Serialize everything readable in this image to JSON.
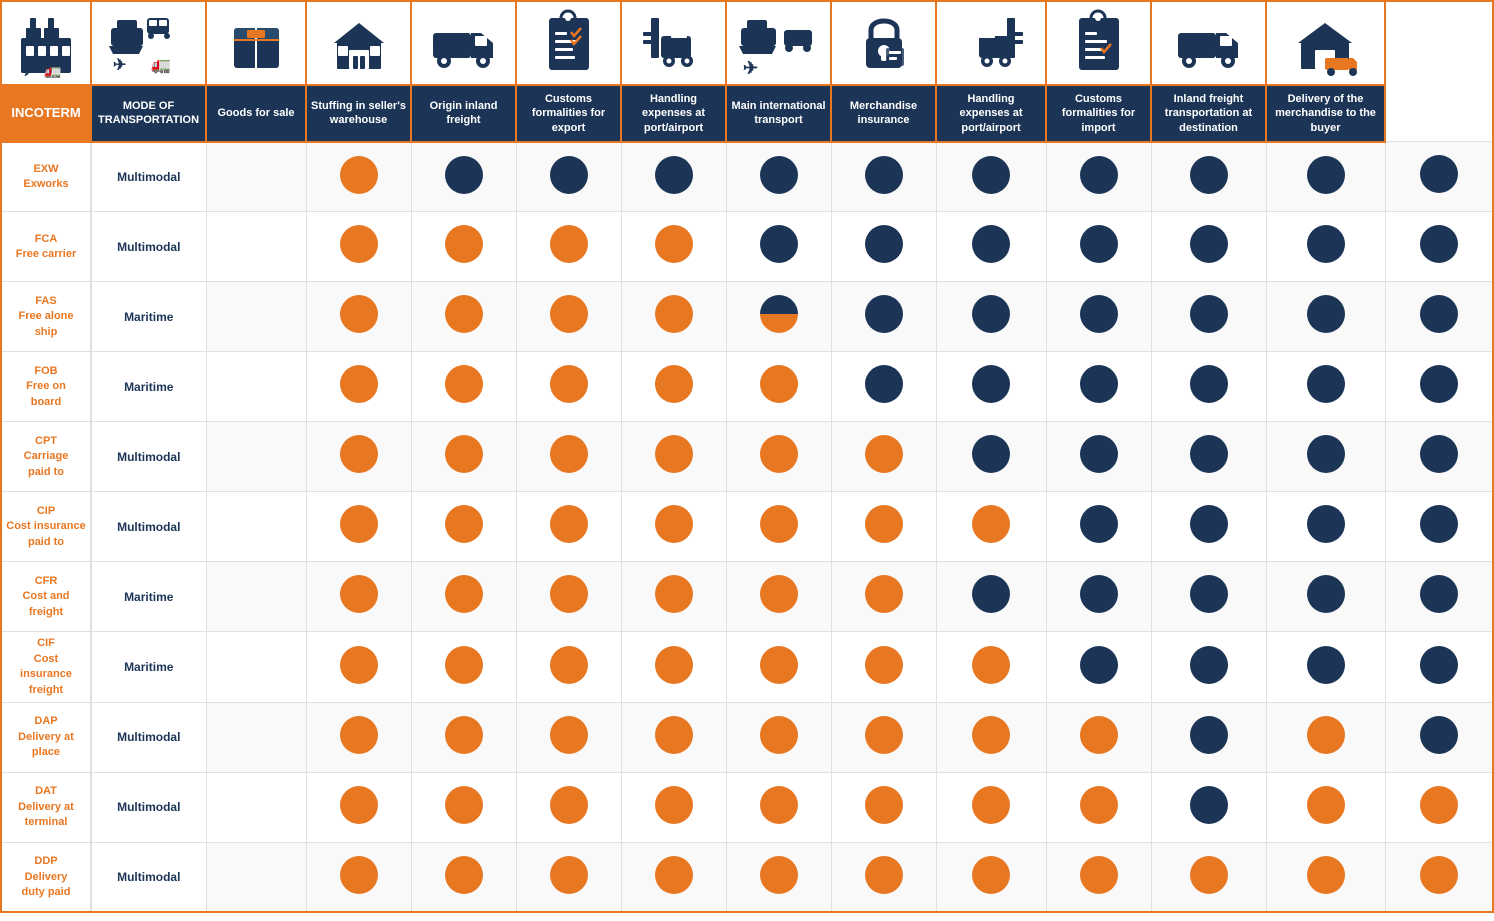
{
  "columns": [
    {
      "id": "incoterm",
      "label": "INCOTERM",
      "icon": "factory"
    },
    {
      "id": "transport",
      "label": "MODE OF TRANSPORTATION",
      "icon": "multimodal"
    },
    {
      "id": "goods",
      "label": "Goods for sale",
      "icon": "box"
    },
    {
      "id": "stuffing",
      "label": "Stuffing in seller's warehouse",
      "icon": "warehouse"
    },
    {
      "id": "origin_inland",
      "label": "Origin inland freight",
      "icon": "truck"
    },
    {
      "id": "customs_export",
      "label": "Customs formalities for export",
      "icon": "checklist"
    },
    {
      "id": "handling_origin",
      "label": "Handling expenses at port/airport",
      "icon": "forklift"
    },
    {
      "id": "main_transport",
      "label": "Main international transport",
      "icon": "ship-plane"
    },
    {
      "id": "insurance",
      "label": "Merchandise insurance",
      "icon": "lock"
    },
    {
      "id": "handling_dest",
      "label": "Handling expenses at port/airport",
      "icon": "forklift2"
    },
    {
      "id": "customs_import",
      "label": "Customs formalities for import",
      "icon": "checklist2"
    },
    {
      "id": "inland_dest",
      "label": "Inland freight transportation at destination",
      "icon": "truck2"
    },
    {
      "id": "delivery",
      "label": "Delivery of the merchandise to the buyer",
      "icon": "warehouse2"
    }
  ],
  "rows": [
    {
      "incoterm": "EXW\nExworks",
      "transport": "Multimodal",
      "goods": "orange",
      "stuffing": "navy",
      "origin_inland": "navy",
      "customs_export": "navy",
      "handling_origin": "navy",
      "main_transport": "navy",
      "insurance": "navy",
      "handling_dest": "navy",
      "customs_import": "navy",
      "inland_dest": "navy",
      "delivery": "navy"
    },
    {
      "incoterm": "FCA\nFree carrier",
      "transport": "Multimodal",
      "goods": "orange",
      "stuffing": "orange",
      "origin_inland": "orange",
      "customs_export": "orange",
      "handling_origin": "navy",
      "main_transport": "navy",
      "insurance": "navy",
      "handling_dest": "navy",
      "customs_import": "navy",
      "inland_dest": "navy",
      "delivery": "navy"
    },
    {
      "incoterm": "FAS\nFree alone\nship",
      "transport": "Maritime",
      "goods": "orange",
      "stuffing": "orange",
      "origin_inland": "orange",
      "customs_export": "orange",
      "handling_origin": "mixed",
      "main_transport": "navy",
      "insurance": "navy",
      "handling_dest": "navy",
      "customs_import": "navy",
      "inland_dest": "navy",
      "delivery": "navy"
    },
    {
      "incoterm": "FOB\nFree on\nboard",
      "transport": "Maritime",
      "goods": "orange",
      "stuffing": "orange",
      "origin_inland": "orange",
      "customs_export": "orange",
      "handling_origin": "orange",
      "main_transport": "navy",
      "insurance": "navy",
      "handling_dest": "navy",
      "customs_import": "navy",
      "inland_dest": "navy",
      "delivery": "navy"
    },
    {
      "incoterm": "CPT\nCarriage\npaid to",
      "transport": "Multimodal",
      "goods": "orange",
      "stuffing": "orange",
      "origin_inland": "orange",
      "customs_export": "orange",
      "handling_origin": "orange",
      "main_transport": "orange",
      "insurance": "navy",
      "handling_dest": "navy",
      "customs_import": "navy",
      "inland_dest": "navy",
      "delivery": "navy"
    },
    {
      "incoterm": "CIP\nCost insurance\npaid to",
      "transport": "Multimodal",
      "goods": "orange",
      "stuffing": "orange",
      "origin_inland": "orange",
      "customs_export": "orange",
      "handling_origin": "orange",
      "main_transport": "orange",
      "insurance": "orange",
      "handling_dest": "navy",
      "customs_import": "navy",
      "inland_dest": "navy",
      "delivery": "navy"
    },
    {
      "incoterm": "CFR\nCost and\nfreight",
      "transport": "Maritime",
      "goods": "orange",
      "stuffing": "orange",
      "origin_inland": "orange",
      "customs_export": "orange",
      "handling_origin": "orange",
      "main_transport": "orange",
      "insurance": "navy",
      "handling_dest": "navy",
      "customs_import": "navy",
      "inland_dest": "navy",
      "delivery": "navy"
    },
    {
      "incoterm": "CIF\nCost\ninsurance\nfreight",
      "transport": "Maritime",
      "goods": "orange",
      "stuffing": "orange",
      "origin_inland": "orange",
      "customs_export": "orange",
      "handling_origin": "orange",
      "main_transport": "orange",
      "insurance": "orange",
      "handling_dest": "navy",
      "customs_import": "navy",
      "inland_dest": "navy",
      "delivery": "navy"
    },
    {
      "incoterm": "DAP\nDelivery at\nplace",
      "transport": "Multimodal",
      "goods": "orange",
      "stuffing": "orange",
      "origin_inland": "orange",
      "customs_export": "orange",
      "handling_origin": "orange",
      "main_transport": "orange",
      "insurance": "orange",
      "handling_dest": "orange",
      "customs_import": "navy",
      "inland_dest": "orange",
      "delivery": "navy"
    },
    {
      "incoterm": "DAT\nDelivery at\nterminal",
      "transport": "Multimodal",
      "goods": "orange",
      "stuffing": "orange",
      "origin_inland": "orange",
      "customs_export": "orange",
      "handling_origin": "orange",
      "main_transport": "orange",
      "insurance": "orange",
      "handling_dest": "orange",
      "customs_import": "navy",
      "inland_dest": "orange",
      "delivery": "orange"
    },
    {
      "incoterm": "DDP\nDelivery\nduty paid",
      "transport": "Multimodal",
      "goods": "orange",
      "stuffing": "orange",
      "origin_inland": "orange",
      "customs_export": "orange",
      "handling_origin": "orange",
      "main_transport": "orange",
      "insurance": "orange",
      "handling_dest": "orange",
      "customs_import": "orange",
      "inland_dest": "orange",
      "delivery": "orange"
    }
  ]
}
